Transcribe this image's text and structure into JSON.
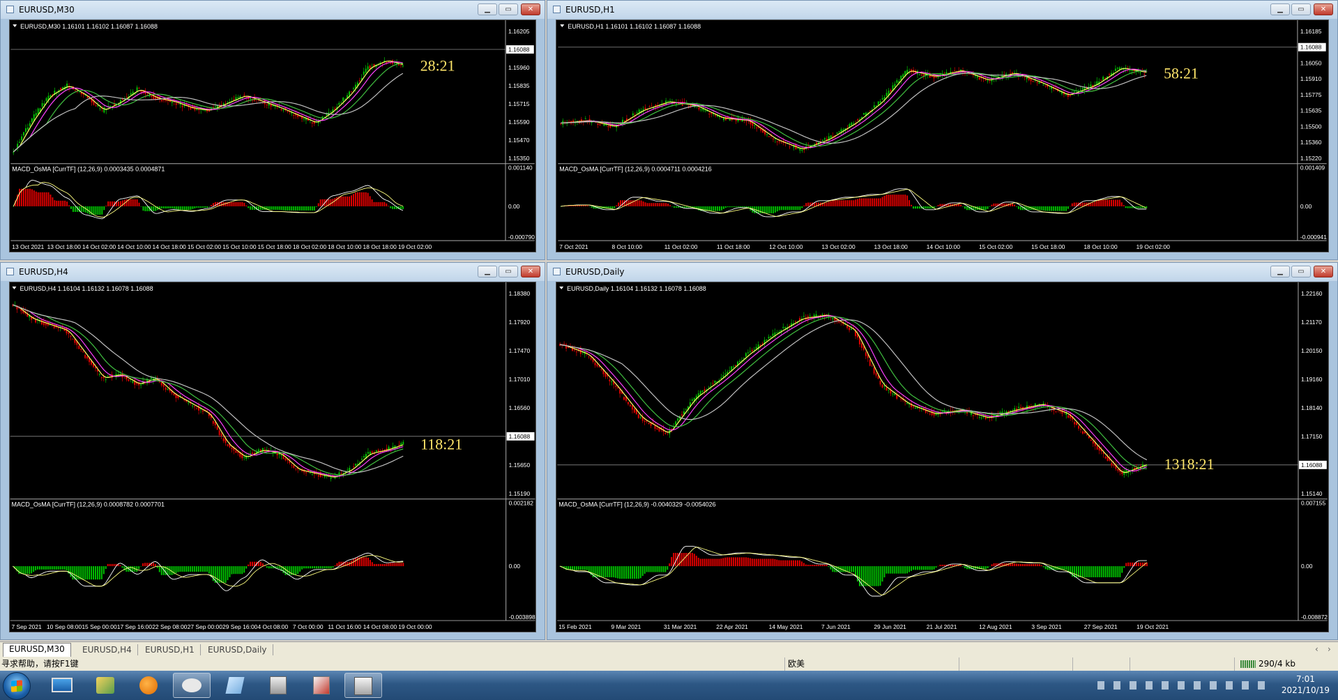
{
  "windows": [
    {
      "id": "m30",
      "title": "EURUSD,M30",
      "header": "EURUSD,M30  1.16101 1.16102 1.16087 1.16088",
      "countdown": "28:21",
      "prices": [
        "1.16205",
        "1.16088",
        "1.15960",
        "1.15835",
        "1.15715",
        "1.15590",
        "1.15470",
        "1.15350"
      ],
      "current_price": "1.16088",
      "indicator_label": "MACD_OsMA [CurrTF] (12,26,9) 0.0003435 0.0004871",
      "indicator_scale": [
        "0.001140",
        "0.00",
        "-0.000790"
      ],
      "dates": [
        "13 Oct 2021",
        "13 Oct 18:00",
        "14 Oct 02:00",
        "14 Oct 10:00",
        "14 Oct 18:00",
        "15 Oct 02:00",
        "15 Oct 10:00",
        "15 Oct 18:00",
        "18 Oct 02:00",
        "18 Oct 10:00",
        "18 Oct 18:00",
        "19 Oct 02:00"
      ],
      "trend": [
        0.95,
        0.7,
        0.5,
        0.42,
        0.5,
        0.62,
        0.55,
        0.45,
        0.52,
        0.55,
        0.6,
        0.62,
        0.56,
        0.5,
        0.55,
        0.6,
        0.66,
        0.72,
        0.62,
        0.48,
        0.28,
        0.22,
        0.26
      ]
    },
    {
      "id": "h1",
      "title": "EURUSD,H1",
      "header": "EURUSD,H1  1.16101 1.16102 1.16087 1.16088",
      "countdown": "58:21",
      "prices": [
        "1.16185",
        "1.16088",
        "1.16050",
        "1.15910",
        "1.15775",
        "1.15635",
        "1.15500",
        "1.15360",
        "1.15220"
      ],
      "current_price": "1.16088",
      "indicator_label": "MACD_OsMA [CurrTF] (12,26,9) 0.0004711 0.0004216",
      "indicator_scale": [
        "0.001409",
        "0.00",
        "-0.000941"
      ],
      "dates": [
        "7 Oct 2021",
        "8 Oct 10:00",
        "11 Oct 02:00",
        "11 Oct 18:00",
        "12 Oct 10:00",
        "13 Oct 02:00",
        "13 Oct 18:00",
        "14 Oct 10:00",
        "15 Oct 02:00",
        "15 Oct 18:00",
        "18 Oct 10:00",
        "19 Oct 02:00"
      ],
      "trend": [
        0.72,
        0.7,
        0.75,
        0.62,
        0.55,
        0.58,
        0.68,
        0.7,
        0.85,
        0.93,
        0.85,
        0.72,
        0.55,
        0.3,
        0.35,
        0.3,
        0.38,
        0.32,
        0.4,
        0.5,
        0.42,
        0.28,
        0.32
      ]
    },
    {
      "id": "h4",
      "title": "EURUSD,H4",
      "header": "EURUSD,H4  1.16104 1.16132 1.16078 1.16088",
      "countdown": "118:21",
      "prices": [
        "1.18380",
        "1.17920",
        "1.17470",
        "1.17010",
        "1.16560",
        "1.16088",
        "1.15650",
        "1.15190"
      ],
      "current_price": "1.16088",
      "indicator_label": "MACD_OsMA [CurrTF] (12,26,9) 0.0008782 0.0007701",
      "indicator_scale": [
        "0.002182",
        "0.00",
        "-0.003898"
      ],
      "dates": [
        "7 Sep 2021",
        "10 Sep 08:00",
        "15 Sep 00:00",
        "17 Sep 16:00",
        "22 Sep 08:00",
        "27 Sep 00:00",
        "29 Sep 16:00",
        "4 Oct 08:00",
        "7 Oct 00:00",
        "11 Oct 16:00",
        "14 Oct 08:00",
        "19 Oct 00:00"
      ],
      "trend": [
        0.05,
        0.12,
        0.15,
        0.18,
        0.3,
        0.42,
        0.4,
        0.45,
        0.42,
        0.5,
        0.55,
        0.6,
        0.75,
        0.82,
        0.78,
        0.8,
        0.88,
        0.9,
        0.92,
        0.88,
        0.8,
        0.78,
        0.75
      ]
    },
    {
      "id": "daily",
      "title": "EURUSD,Daily",
      "header": "EURUSD,Daily  1.16104 1.16132 1.16078 1.16088",
      "countdown": "1318:21",
      "prices": [
        "1.22160",
        "1.21170",
        "1.20150",
        "1.19160",
        "1.18140",
        "1.17150",
        "1.16088",
        "1.15140"
      ],
      "current_price": "1.16088",
      "indicator_label": "MACD_OsMA [CurrTF] (12,26,9) -0.0040329 -0.0054026",
      "indicator_scale": [
        "0.007155",
        "0.00",
        "-0.008872"
      ],
      "dates": [
        "15 Feb 2021",
        "9 Mar 2021",
        "31 Mar 2021",
        "22 Apr 2021",
        "14 May 2021",
        "7 Jun 2021",
        "29 Jun 2021",
        "21 Jul 2021",
        "12 Aug 2021",
        "3 Sep 2021",
        "27 Sep 2021",
        "19 Oct 2021"
      ],
      "trend": [
        0.25,
        0.3,
        0.45,
        0.62,
        0.7,
        0.52,
        0.42,
        0.3,
        0.2,
        0.12,
        0.1,
        0.18,
        0.45,
        0.55,
        0.6,
        0.58,
        0.62,
        0.58,
        0.55,
        0.6,
        0.75,
        0.9,
        0.85
      ]
    }
  ],
  "tabs": [
    "EURUSD,M30",
    "EURUSD,H4",
    "EURUSD,H1",
    "EURUSD,Daily"
  ],
  "active_tab": "EURUSD,M30",
  "status": {
    "help": "寻求帮助，请按F1键",
    "profile": "欧美",
    "traffic": "290/4 kb"
  },
  "clock": {
    "time": "7:01",
    "date": "2021/10/19"
  },
  "colors": {
    "countdown": "#ffe66a",
    "bull_bar": "#00c000",
    "bear_bar": "#e00000",
    "ma_fast": "#ffff66",
    "ma_mid": "#ff40ff",
    "ma_slow": "#40c040",
    "ma_long": "#c0c0c0"
  }
}
